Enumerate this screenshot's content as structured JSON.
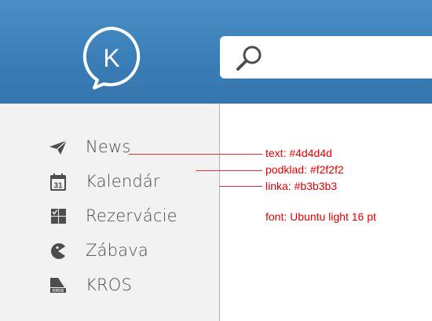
{
  "header": {
    "logo_letter": "K",
    "search_placeholder": "",
    "colors": {
      "header": "#3a7fb8"
    }
  },
  "sidebar": {
    "items": [
      {
        "label": "News",
        "icon": "paper-plane-icon"
      },
      {
        "label": "Kalendár",
        "icon": "calendar-icon",
        "icon_text": "31"
      },
      {
        "label": "Rezervácie",
        "icon": "grid-check-icon"
      },
      {
        "label": "Zábava",
        "icon": "pacman-icon"
      },
      {
        "label": "KROS",
        "icon": "kros-logo-icon",
        "icon_text": "KROS"
      }
    ]
  },
  "annotations": {
    "text_color": "text: #4d4d4d",
    "background": "podklad: #f2f2f2",
    "line": "linka: #b3b3b3",
    "font": "font: Ubuntu light 16 pt"
  },
  "colors": {
    "text": "#4d4d4d",
    "background": "#f2f2f2",
    "line": "#b3b3b3",
    "annotation": "#e00000"
  }
}
